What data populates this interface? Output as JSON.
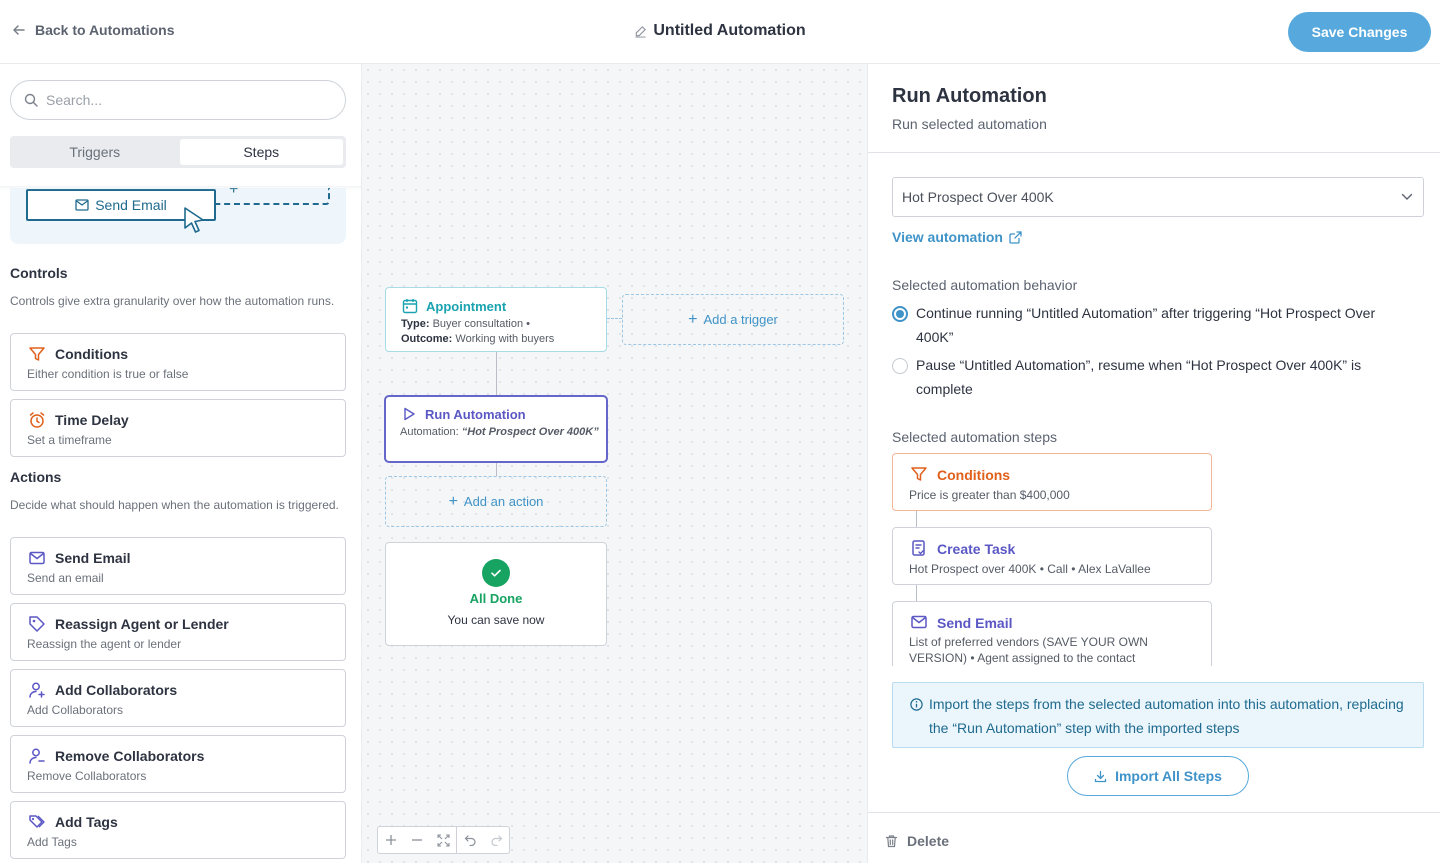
{
  "header": {
    "back_label": "Back to Automations",
    "title": "Untitled Automation",
    "save_label": "Save Changes"
  },
  "sidebar": {
    "search_placeholder": "Search...",
    "tabs": [
      {
        "label": "Triggers",
        "active": false
      },
      {
        "label": "Steps",
        "active": true
      }
    ],
    "promo_button": "Send Email",
    "controls": {
      "title": "Controls",
      "description": "Controls give extra granularity over how the automation runs.",
      "items": [
        {
          "title": "Conditions",
          "description": "Either condition is true or false",
          "icon": "filter-icon"
        },
        {
          "title": "Time Delay",
          "description": "Set a timeframe",
          "icon": "alarm-clock-icon"
        }
      ]
    },
    "actions": {
      "title": "Actions",
      "description": "Decide what should happen when the automation is triggered.",
      "items": [
        {
          "title": "Send Email",
          "description": "Send an email",
          "icon": "envelope-icon"
        },
        {
          "title": "Reassign Agent or Lender",
          "description": "Reassign the agent or lender",
          "icon": "tag-icon"
        },
        {
          "title": "Add Collaborators",
          "description": "Add Collaborators",
          "icon": "user-plus-icon"
        },
        {
          "title": "Remove Collaborators",
          "description": "Remove Collaborators",
          "icon": "user-minus-icon"
        },
        {
          "title": "Add Tags",
          "description": "Add Tags",
          "icon": "tags-icon"
        }
      ]
    }
  },
  "canvas": {
    "trigger_node": {
      "title": "Appointment",
      "type_label": "Type:",
      "type_value": "Buyer consultation",
      "separator": "•",
      "outcome_label": "Outcome:",
      "outcome_value": "Working with buyers"
    },
    "add_trigger": "Add a trigger",
    "run_node": {
      "title": "Run Automation",
      "automation_label": "Automation:",
      "automation_value": "“Hot Prospect Over 400K”"
    },
    "add_action": "Add an action",
    "done_node": {
      "title": "All Done",
      "description": "You can save now"
    }
  },
  "panel": {
    "title": "Run Automation",
    "subtitle": "Run selected automation",
    "selected_automation": "Hot Prospect Over 400K",
    "view_link": "View automation",
    "behavior_label": "Selected automation behavior",
    "behavior_options": [
      {
        "text": "Continue running “Untitled Automation” after triggering “Hot Prospect Over 400K”",
        "selected": true
      },
      {
        "text": "Pause “Untitled Automation”, resume when “Hot Prospect Over 400K” is complete",
        "selected": false
      }
    ],
    "steps_label": "Selected automation steps",
    "steps": [
      {
        "title": "Conditions",
        "description": "Price is greater than $400,000",
        "color": "#e0601b"
      },
      {
        "title": "Create Task",
        "description": "Hot Prospect over 400K • Call • Alex LaVallee",
        "color": "#5b57c4"
      },
      {
        "title": "Send Email",
        "description": "List of preferred vendors (SAVE YOUR OWN VERSION) • Agent assigned to the contact",
        "color": "#5b57c4"
      }
    ],
    "info_text": "Import the steps from the selected automation into this automation, replacing the “Run Automation” step with the imported steps",
    "import_label": "Import All Steps",
    "delete_label": "Delete"
  },
  "colors": {
    "accent": "#57a9dd",
    "link": "#3f93c8",
    "trigger": "#1aa3b0",
    "step_purple": "#5b57c4",
    "control_orange": "#e0601b",
    "success": "#17a361"
  }
}
